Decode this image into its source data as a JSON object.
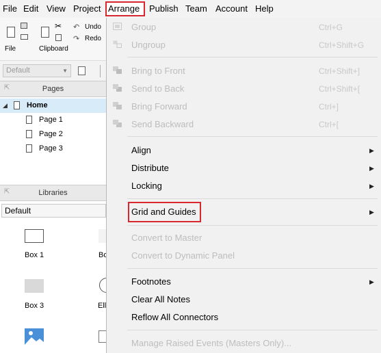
{
  "menubar": {
    "items": [
      "File",
      "Edit",
      "View",
      "Project",
      "Arrange",
      "Publish",
      "Team",
      "Account",
      "Help"
    ],
    "active": "Arrange"
  },
  "toolbar": {
    "file_label": "File",
    "clipboard_label": "Clipboard",
    "undo_label": "Undo",
    "redo_label": "Redo",
    "style_select_value": "Default"
  },
  "pages": {
    "title": "Pages",
    "items": [
      {
        "label": "Home",
        "level": 0,
        "selected": true
      },
      {
        "label": "Page 1",
        "level": 1
      },
      {
        "label": "Page 2",
        "level": 1
      },
      {
        "label": "Page 3",
        "level": 1
      }
    ]
  },
  "libraries": {
    "title": "Libraries",
    "selected": "Default",
    "widgets": [
      {
        "label": "Box 1",
        "icon": "box-outline-icon"
      },
      {
        "label": "Bo",
        "icon": "box-outline-icon"
      },
      {
        "label": "Box 3",
        "icon": "box-filled-icon"
      },
      {
        "label": "Elli",
        "icon": "ellipse-icon"
      },
      {
        "label": "",
        "icon": "image-icon"
      },
      {
        "label": "",
        "icon": "placeholder-icon"
      }
    ]
  },
  "arrange_menu": {
    "items": [
      {
        "label": "Group",
        "shortcut": "Ctrl+G",
        "disabled": true,
        "icon": "group-icon"
      },
      {
        "label": "Ungroup",
        "shortcut": "Ctrl+Shift+G",
        "disabled": true,
        "icon": "ungroup-icon"
      },
      {
        "label": "Bring to Front",
        "shortcut": "Ctrl+Shift+]",
        "disabled": true,
        "icon": "bring-to-front-icon"
      },
      {
        "label": "Send to Back",
        "shortcut": "Ctrl+Shift+[",
        "disabled": true,
        "icon": "send-to-back-icon"
      },
      {
        "label": "Bring Forward",
        "shortcut": "Ctrl+]",
        "disabled": true,
        "icon": "bring-forward-icon"
      },
      {
        "label": "Send Backward",
        "shortcut": "Ctrl+[",
        "disabled": true,
        "icon": "send-backward-icon"
      },
      {
        "label": "Align",
        "submenu": true
      },
      {
        "label": "Distribute",
        "submenu": true
      },
      {
        "label": "Locking",
        "submenu": true
      },
      {
        "label": "Grid and Guides",
        "submenu": true,
        "highlighted": true
      },
      {
        "label": "Convert to Master",
        "disabled": true
      },
      {
        "label": "Convert to Dynamic Panel",
        "disabled": true
      },
      {
        "label": "Footnotes",
        "submenu": true
      },
      {
        "label": "Clear All Notes"
      },
      {
        "label": "Reflow All Connectors"
      },
      {
        "label": "Manage Raised Events (Masters Only)...",
        "disabled": true
      }
    ]
  },
  "colors": {
    "highlight_border": "#d7262e",
    "selected_row": "#d7ebf8"
  }
}
